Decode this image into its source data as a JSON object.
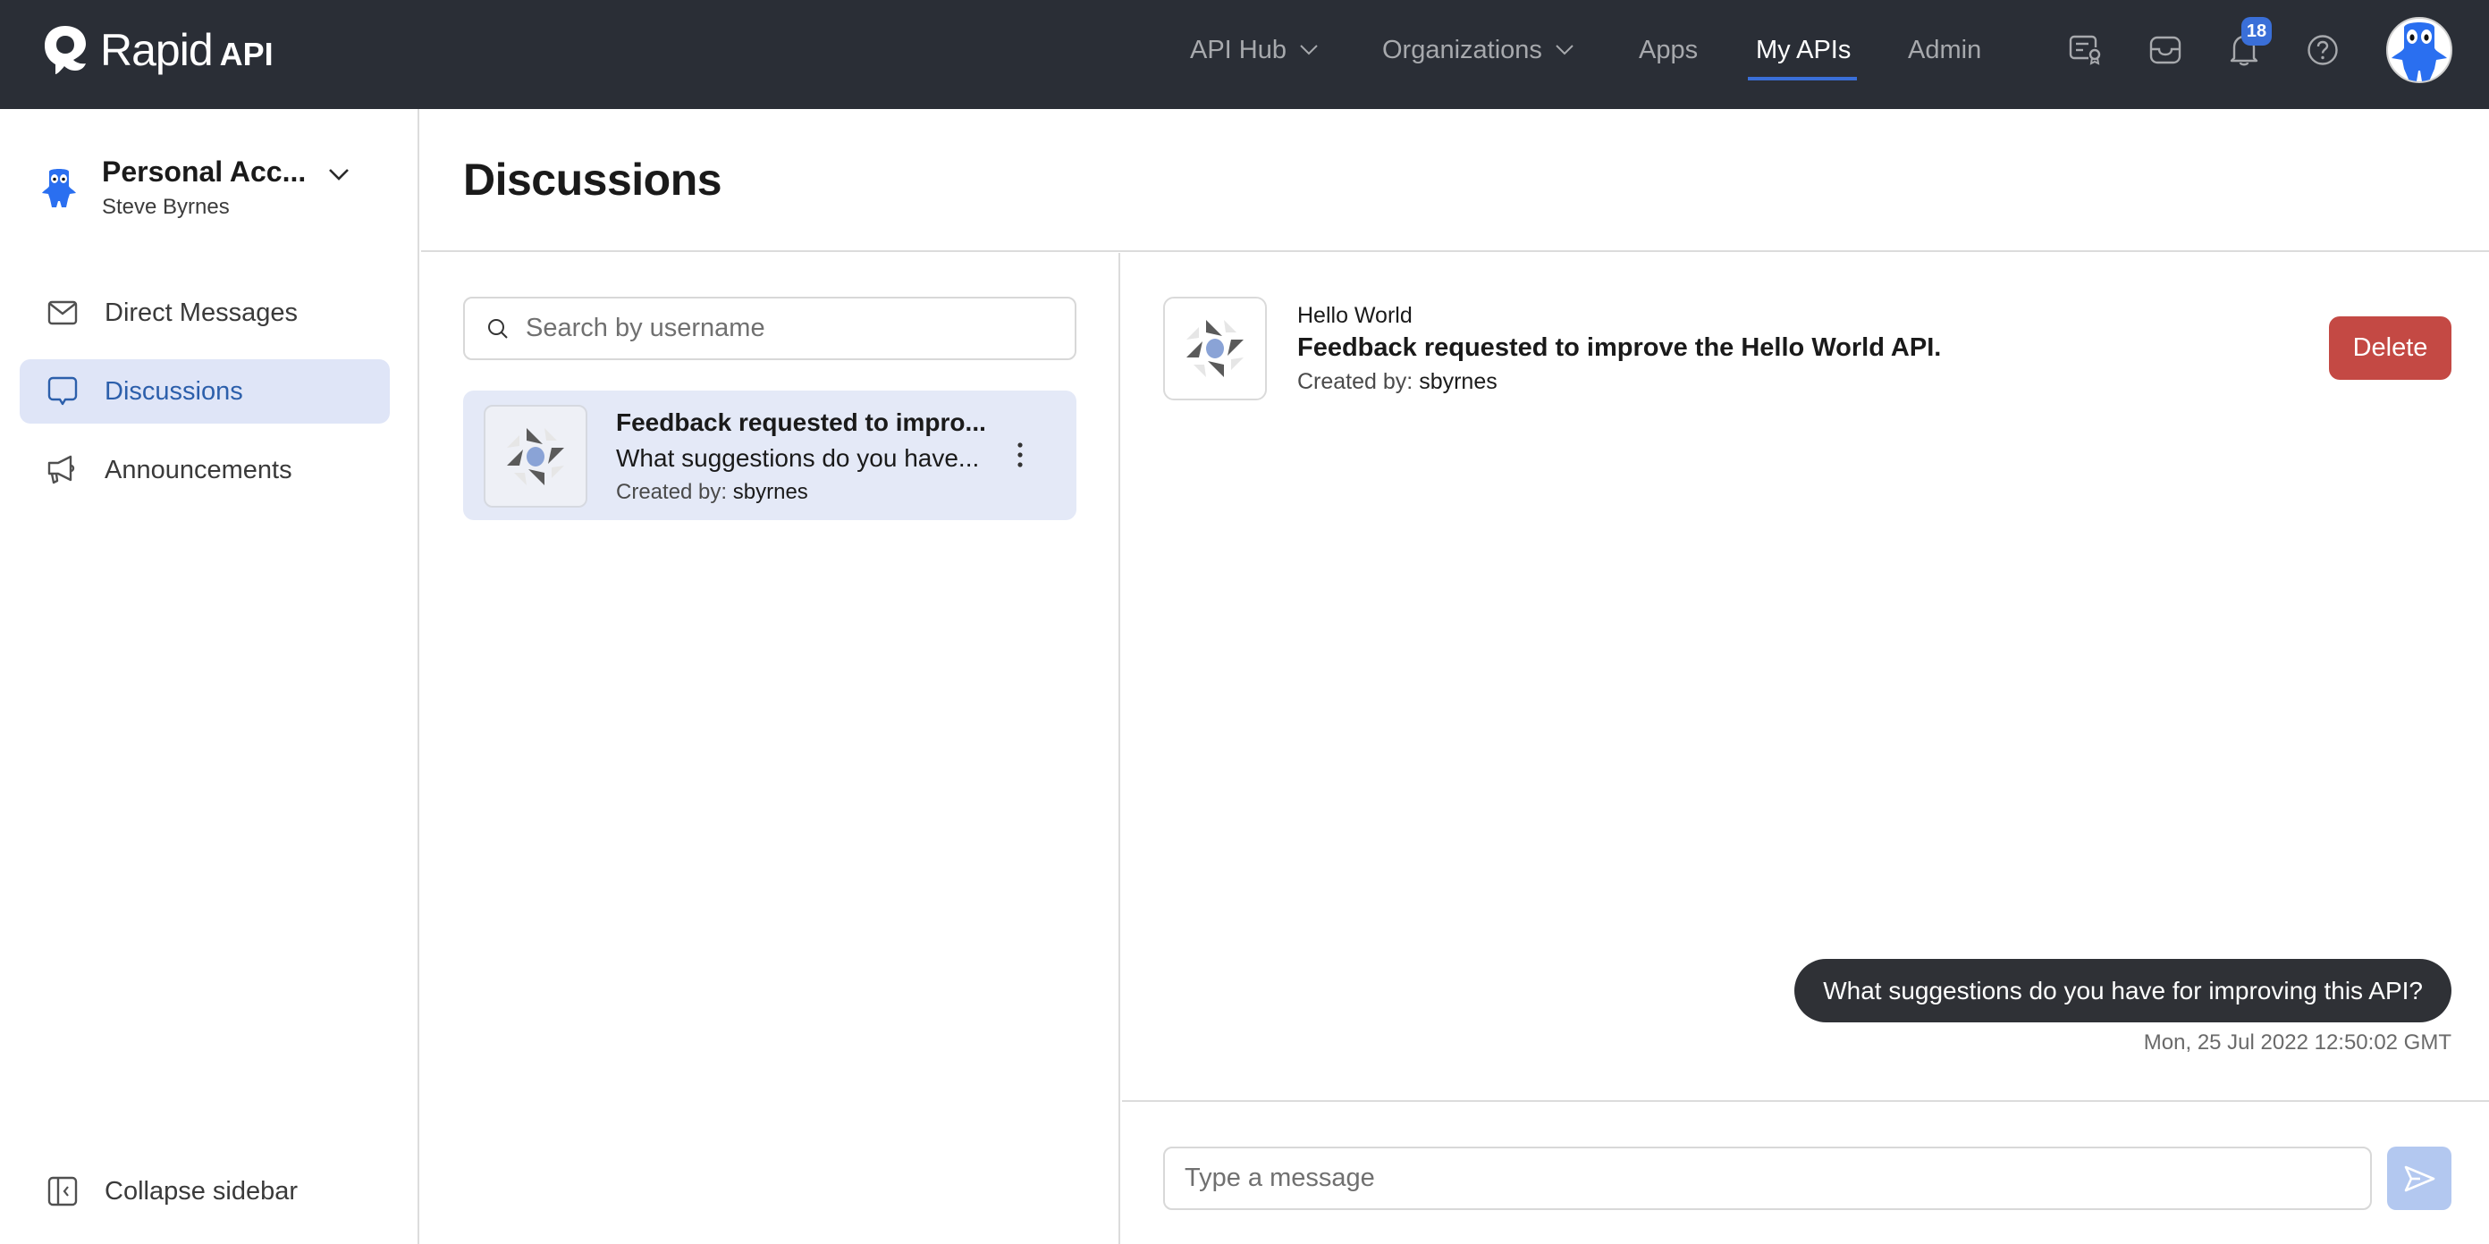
{
  "app": {
    "brand_primary": "Rapid",
    "brand_secondary": "API",
    "colors": {
      "header_bg": "#2a2e36",
      "accent": "#3a6fd8",
      "active_item_bg": "#dfe5f7",
      "delete": "#c44944",
      "send_disabled": "#b3c8f0"
    }
  },
  "topnav": {
    "items": [
      {
        "label": "API Hub",
        "has_dropdown": true,
        "active": false
      },
      {
        "label": "Organizations",
        "has_dropdown": true,
        "active": false
      },
      {
        "label": "Apps",
        "has_dropdown": false,
        "active": false
      },
      {
        "label": "My APIs",
        "has_dropdown": false,
        "active": true
      },
      {
        "label": "Admin",
        "has_dropdown": false,
        "active": false
      }
    ],
    "icons": [
      "certificate-icon",
      "inbox-icon",
      "bell-icon",
      "help-icon"
    ],
    "notification_count": "18",
    "avatar": "user-mascot-avatar"
  },
  "sidebar": {
    "account": {
      "name": "Personal Acc...",
      "user": "Steve Byrnes"
    },
    "items": [
      {
        "label": "Direct Messages",
        "icon": "mail-icon",
        "active": false
      },
      {
        "label": "Discussions",
        "icon": "chat-bubble-icon",
        "active": true
      },
      {
        "label": "Announcements",
        "icon": "megaphone-icon",
        "active": false
      }
    ],
    "collapse_label": "Collapse sidebar"
  },
  "main": {
    "title": "Discussions",
    "search": {
      "placeholder": "Search by username",
      "value": ""
    },
    "discussions": [
      {
        "title": "Feedback requested to impro...",
        "preview": "What suggestions do you have...",
        "created_by_label": "Created by:",
        "created_by": "sbyrnes",
        "selected": true
      }
    ]
  },
  "detail": {
    "api_name": "Hello World",
    "title": "Feedback requested to improve the Hello World API.",
    "created_by_label": "Created by:",
    "created_by": "sbyrnes",
    "delete_label": "Delete",
    "messages": [
      {
        "text": "What suggestions do you have for improving this API?",
        "timestamp": "Mon, 25 Jul 2022 12:50:02 GMT"
      }
    ],
    "composer": {
      "placeholder": "Type a message",
      "value": ""
    }
  }
}
